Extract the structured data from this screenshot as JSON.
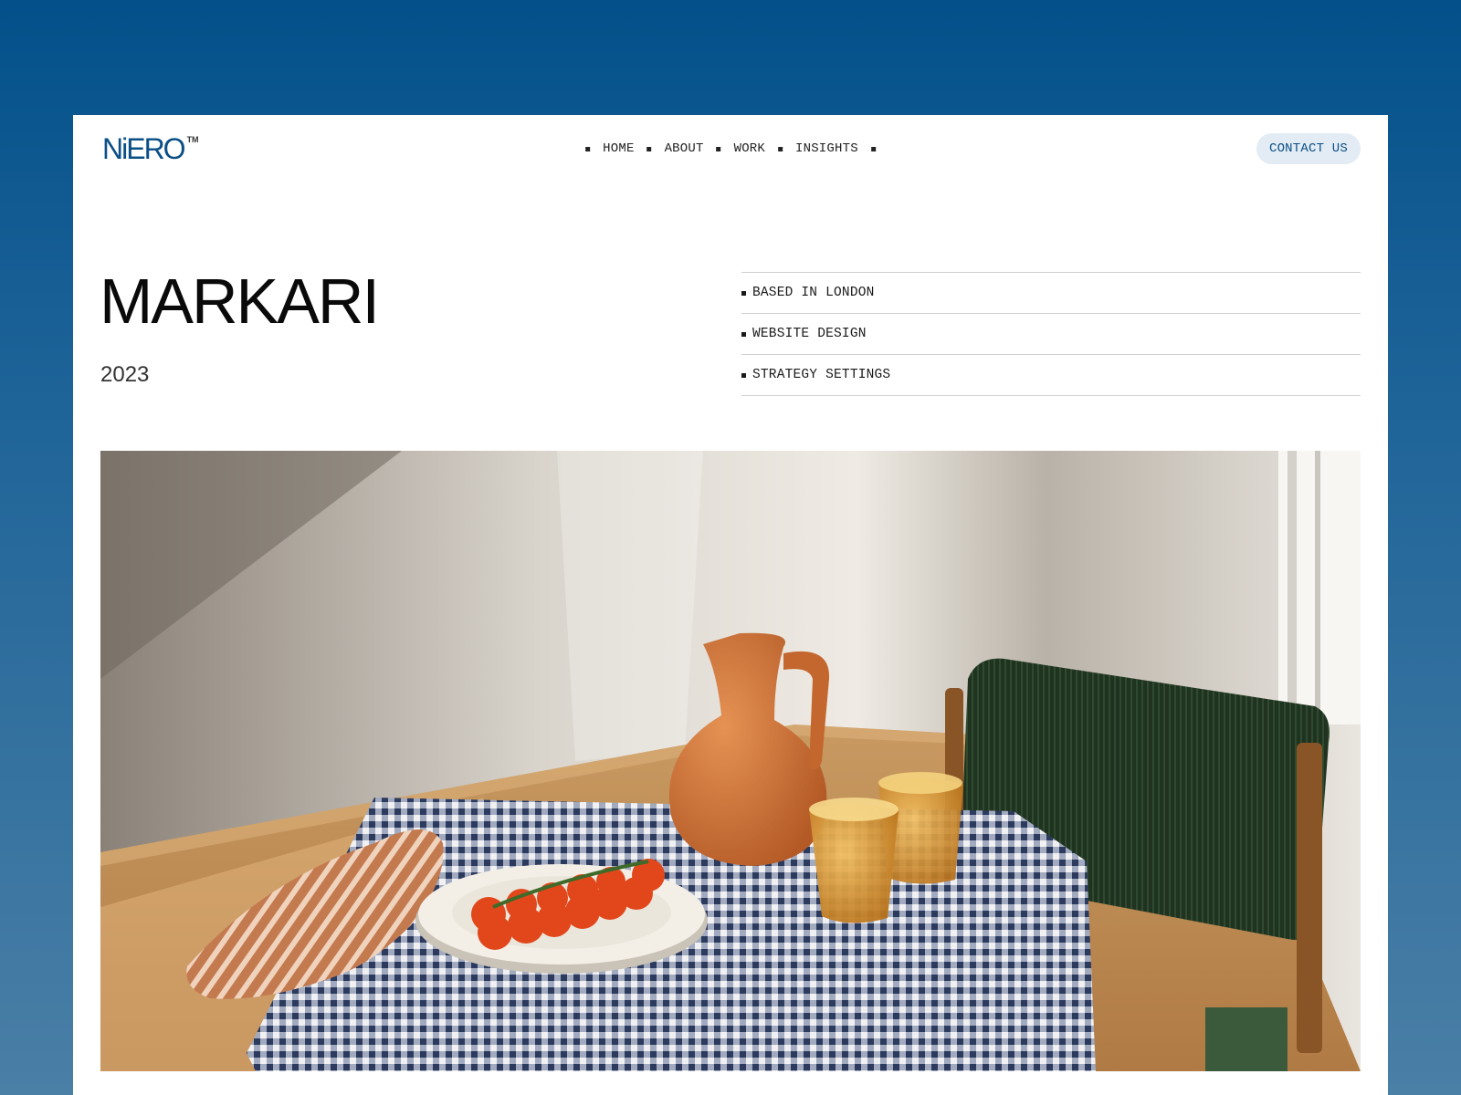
{
  "brand": {
    "name": "NiERO",
    "tm": "TM",
    "color": "#0a4f86"
  },
  "nav": {
    "items": [
      {
        "label": "HOME"
      },
      {
        "label": "ABOUT"
      },
      {
        "label": "WORK"
      },
      {
        "label": "INSIGHTS"
      }
    ],
    "contact_label": "CONTACT US"
  },
  "project": {
    "title": "MARKARI",
    "year": "2023",
    "tags": [
      {
        "label": "BASED IN LONDON"
      },
      {
        "label": "WEBSITE DESIGN"
      },
      {
        "label": "STRATEGY SETTINGS"
      }
    ]
  },
  "colors": {
    "background_top": "#03508a",
    "background_bottom": "#4a7fa6",
    "card": "#ffffff",
    "accent": "#0a4f86",
    "contact_bg": "#e3ecf4"
  }
}
